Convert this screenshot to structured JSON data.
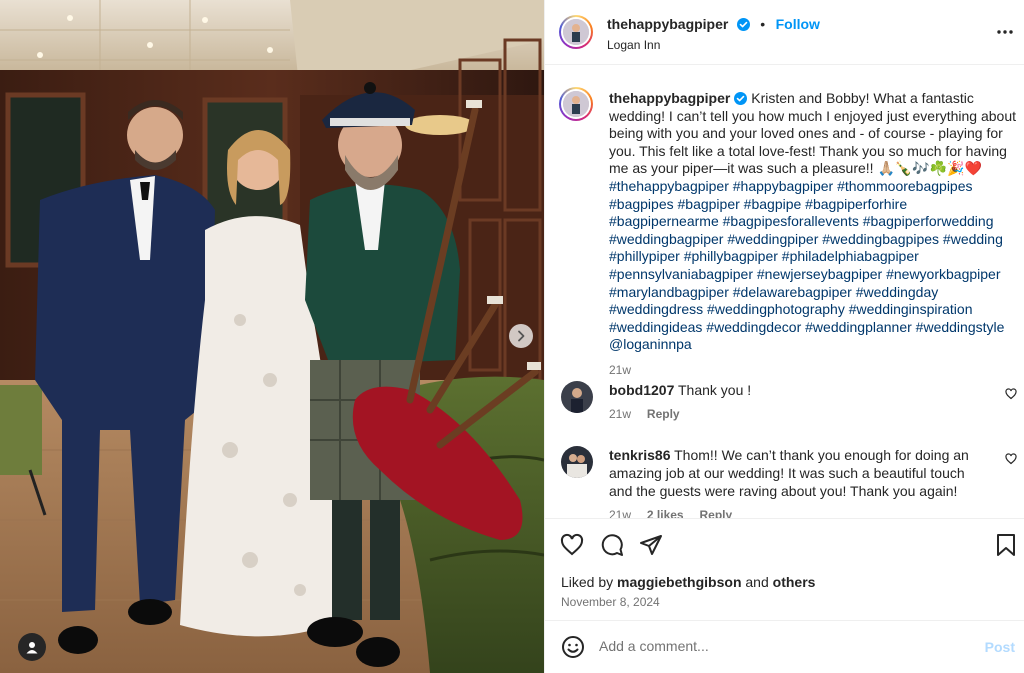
{
  "post": {
    "username": "thehappybagpiper",
    "follow_label": "Follow",
    "separator": "•",
    "location": "Logan Inn"
  },
  "caption": {
    "username": "thehappybagpiper",
    "text": "Kristen and Bobby! What a fantastic wedding! I can’t tell you how much I enjoyed just everything about being with you and your loved ones and - of course - playing for you. This felt like a total love-fest! Thank you so much for having me as your piper—it was such a pleasure!! 🙏🏼🍾🎶☘️🎉❤️",
    "hashtags": "#thehappybagpiper #happybagpiper #thommoorebagpipes #bagpipes #bagpiper #bagpipe #bagpiperforhire #bagpipernearme #bagpipesforallevents #bagpiperforwedding #weddingbagpiper #weddingpiper #weddingbagpipes #wedding #phillypiper #phillybagpiper #philadelphiabagpiper #pennsylvaniabagpiper #newjerseybagpiper #newyorkbagpiper #marylandbagpiper #delawarebagpiper #weddingday #weddingdress #weddingphotography #weddinginspiration #weddingideas #weddingdecor #weddingplanner #weddingstyle @loganinnpa",
    "time": "21w"
  },
  "comments": [
    {
      "username": "bobd1207",
      "text": "Thank you !",
      "time": "21w",
      "likes": "",
      "reply_label": "Reply"
    },
    {
      "username": "tenkris86",
      "text": "Thom!! We can’t thank you enough for doing an amazing job at our wedding! It was such a beautiful touch and the guests were raving about you! Thank you again!",
      "time": "21w",
      "likes": "2 likes",
      "reply_label": "Reply"
    }
  ],
  "likes": {
    "prefix": "Liked by",
    "user": "maggiebethgibson",
    "and": "and",
    "others": "others"
  },
  "date": "November 8, 2024",
  "add_comment": {
    "placeholder": "Add a comment...",
    "post_label": "Post"
  },
  "icons": {
    "verified": "verified-badge-icon",
    "more": "more-options-icon",
    "like": "heart-icon",
    "comment": "comment-icon",
    "share": "share-icon",
    "save": "bookmark-icon",
    "emoji": "emoji-icon",
    "next": "chevron-right-icon",
    "tag": "user-tag-icon"
  },
  "colors": {
    "link_blue": "#0095f6",
    "hashtag": "#00376b",
    "muted": "#737373",
    "verified": "#0095f6"
  }
}
